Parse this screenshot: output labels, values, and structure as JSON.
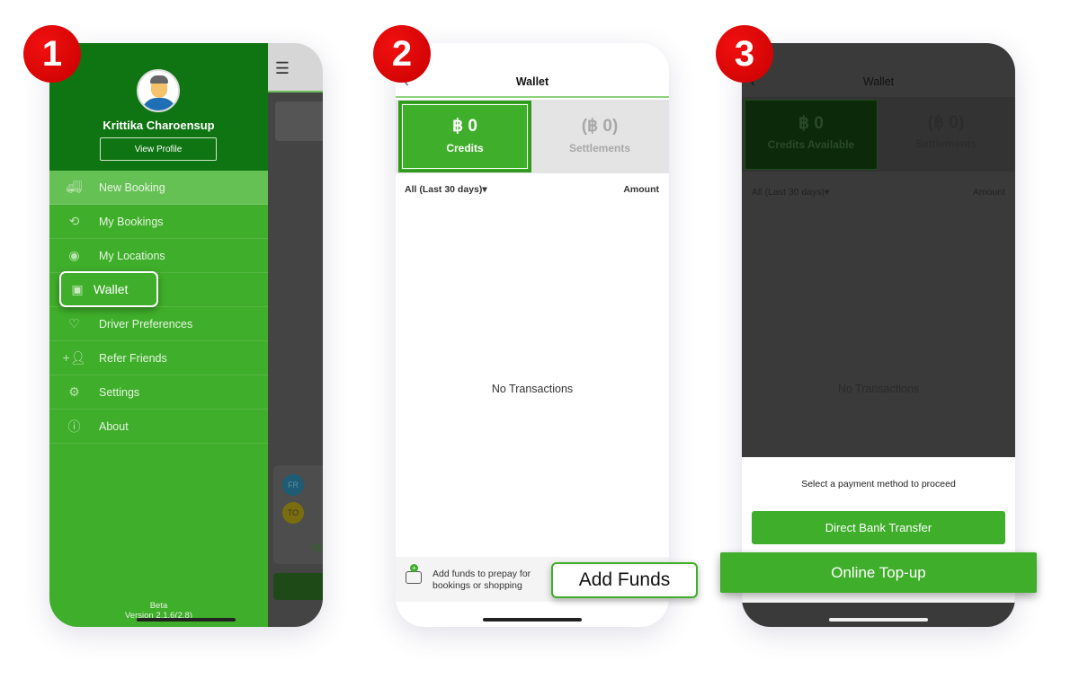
{
  "steps": [
    "1",
    "2",
    "3"
  ],
  "colors": {
    "brand_green": "#3fae2a",
    "dark_green": "#0f7512",
    "badge_red": "#e00000"
  },
  "phone1": {
    "user_name": "Krittika Charoensup",
    "view_profile": "View Profile",
    "menu": [
      {
        "label": "New Booking",
        "icon": "truck-icon"
      },
      {
        "label": "My Bookings",
        "icon": "history-icon"
      },
      {
        "label": "My Locations",
        "icon": "location-pin-icon"
      },
      {
        "label": "Wallet",
        "icon": "wallet-icon"
      },
      {
        "label": "Driver Preferences",
        "icon": "heart-icon"
      },
      {
        "label": "Refer Friends",
        "icon": "add-person-icon"
      },
      {
        "label": "Settings",
        "icon": "gear-icon"
      },
      {
        "label": "About",
        "icon": "info-icon"
      }
    ],
    "beta": "Beta",
    "version": "Version 2.1.6(2.8)",
    "from_label": "FR",
    "to_label": "TO",
    "option_partial": "Op"
  },
  "phone2": {
    "title": "Wallet",
    "credits_amount": "฿ 0",
    "credits_label": "Credits",
    "settlements_amount": "(฿ 0)",
    "settlements_label": "Settlements",
    "filter": "All (Last 30 days)",
    "amount_header": "Amount",
    "empty": "No Transactions",
    "add_funds_hint": "Add funds to prepay for bookings or shopping",
    "add_funds_button": "Add Funds"
  },
  "phone3": {
    "title": "Wallet",
    "credits_amount": "฿ 0",
    "credits_label": "Credits Available",
    "settlements_amount": "(฿ 0)",
    "settlements_label": "Settlements",
    "filter": "All (Last 30 days)",
    "amount_header": "Amount",
    "empty": "No Transactions",
    "prompt": "Select a payment method to proceed",
    "bank_transfer": "Direct Bank Transfer",
    "online_topup": "Online Top-up"
  }
}
